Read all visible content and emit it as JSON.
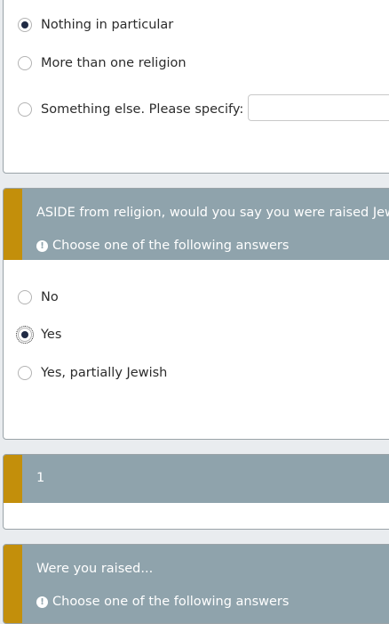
{
  "q1": {
    "options": [
      {
        "label": "Nothing in particular",
        "checked": true
      },
      {
        "label": "More than one religion",
        "checked": false
      },
      {
        "label": "Something else. Please specify:",
        "checked": false
      }
    ],
    "specify_value": ""
  },
  "q2": {
    "question": "ASIDE from religion, would you say you were raised Jewish?",
    "hint": "Choose one of the following answers",
    "options": [
      {
        "label": "No",
        "checked": false
      },
      {
        "label": "Yes",
        "checked": true
      },
      {
        "label": "Yes, partially Jewish",
        "checked": false
      }
    ]
  },
  "q3": {
    "question": "1"
  },
  "q4": {
    "question": "Were you raised...",
    "hint": "Choose one of the following answers"
  },
  "colors": {
    "header_bg": "#8fa3ac",
    "accent": "#c38f0b",
    "radio_checked": "#1f2a44"
  },
  "icons": {
    "hint": "exclamation-circle-icon"
  }
}
